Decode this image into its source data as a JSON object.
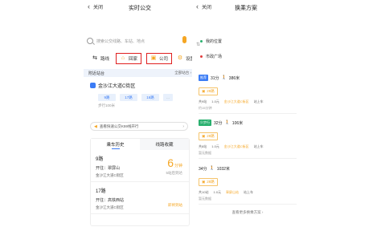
{
  "left": {
    "back_label": "关闭",
    "title": "实时公交",
    "search_placeholder": "搜索公交线路、车站、地点",
    "shortcuts": [
      {
        "label": "路线",
        "icon": "route-icon"
      },
      {
        "label": "回家",
        "icon": "home-icon"
      },
      {
        "label": "公司",
        "icon": "briefcase-icon"
      },
      {
        "label": "设置",
        "icon": "gear-icon"
      }
    ],
    "section_title": "附近站台",
    "section_more": "全部站台 ›",
    "stop": {
      "name": "金沙江大道C街区",
      "chips": [
        "9路",
        "17路",
        "16路",
        "…"
      ],
      "distance": "步行100米"
    },
    "notice": "查看快速公交K59线开行",
    "tabs": [
      "乘车历史",
      "线路收藏"
    ],
    "history": [
      {
        "route": "9路",
        "dir": "开往：翠屏山",
        "stop": "金沙江大道C街区",
        "time": "6",
        "unit": "分钟",
        "status": "5站后到达"
      },
      {
        "route": "17路",
        "dir": "开往：高铁西站",
        "stop": "金沙江大道C街区",
        "time": "",
        "unit": "",
        "status": "即将到站"
      }
    ]
  },
  "right": {
    "back_label": "关闭",
    "title": "换乘方案",
    "origin": "我的位置",
    "destination": "市政广场",
    "plans": [
      {
        "tag": "推荐",
        "time": "31分",
        "walk": "386米",
        "route": "29路",
        "meta": [
          "共9站",
          "1.0元",
          "金沙江大道C街区",
          "站上车"
        ],
        "sub": "约15分钟"
      },
      {
        "tag": "少步行",
        "time": "32分",
        "walk": "106米",
        "route": "29路",
        "meta": [
          "共8站",
          "1.0元",
          "金沙江大道C街区",
          "站上车"
        ],
        "sub": "暂无数据"
      },
      {
        "tag": "",
        "time": "34分",
        "walk": "1032米",
        "route": "28路",
        "meta": [
          "共10站",
          "1.0元",
          "翠屏山站",
          "站上车"
        ],
        "sub": "暂无数据"
      }
    ],
    "see_more": "查看更多换乘方案 ›"
  }
}
